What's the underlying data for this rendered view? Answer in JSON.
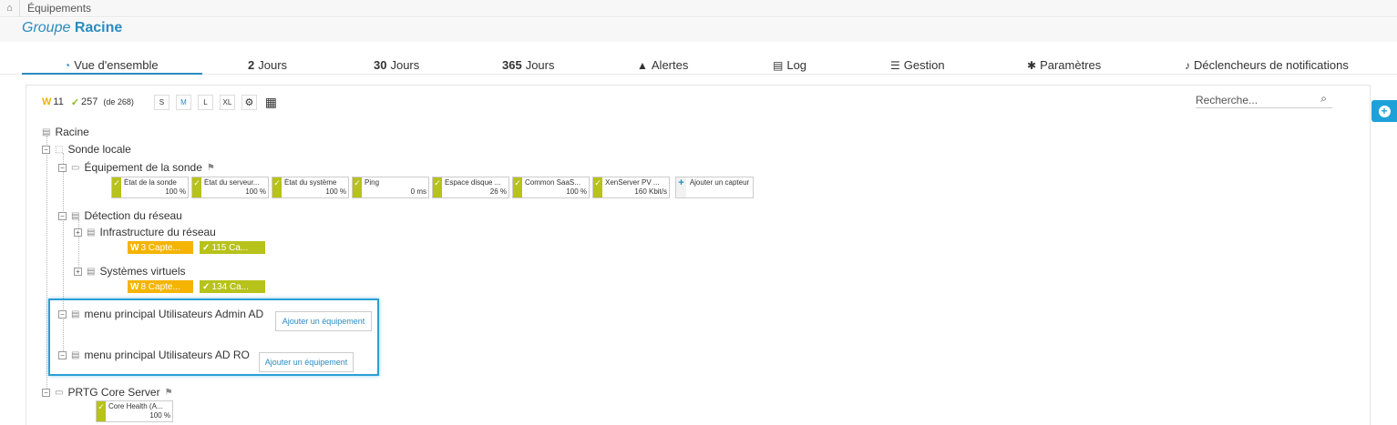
{
  "breadcrumb": {
    "home_icon": "home-icon",
    "item": "Équipements"
  },
  "header": {
    "title_prefix": "Groupe",
    "title_name": "Racine"
  },
  "tabs": [
    {
      "label": "Vue d'ensemble",
      "icon": "overview-icon"
    },
    {
      "num": "2",
      "label": "Jours"
    },
    {
      "num": "30",
      "label": "Jours"
    },
    {
      "num": "365",
      "label": "Jours"
    },
    {
      "label": "Alertes",
      "icon": "warning-icon"
    },
    {
      "label": "Log",
      "icon": "log-icon"
    },
    {
      "label": "Gestion",
      "icon": "sliders-icon"
    },
    {
      "label": "Paramètres",
      "icon": "gear-icon"
    },
    {
      "label": "Déclencheurs de notifications",
      "icon": "bell-icon"
    }
  ],
  "toolbar": {
    "warn_badge": "W",
    "warn_count": "11",
    "ok_count": "257",
    "total": "(de 268)",
    "sizes": [
      "S",
      "M",
      "L",
      "XL"
    ],
    "selected_size": "M"
  },
  "search": {
    "placeholder": "Recherche..."
  },
  "tree": {
    "root": "Racine",
    "probe": "Sonde locale",
    "probe_device": "Équipement de la sonde",
    "sensors": [
      {
        "name": "État de la sonde",
        "value": "100 %"
      },
      {
        "name": "État du serveur...",
        "value": "100 %"
      },
      {
        "name": "État du système",
        "value": "100 %"
      },
      {
        "name": "Ping",
        "value": "0 ms"
      },
      {
        "name": "Espace disque ...",
        "value": "26 %"
      },
      {
        "name": "Common SaaS...",
        "value": "100 %"
      },
      {
        "name": "XenServer PV ...",
        "value": "160 Kbit/s"
      }
    ],
    "add_sensor": "Ajouter un capteur",
    "discovery": "Détection du réseau",
    "infra": "Infrastructure du réseau",
    "infra_warn": "3 Capte...",
    "infra_ok": "115 Ca...",
    "virtual": "Systèmes virtuels",
    "virtual_warn": "8 Capte...",
    "virtual_ok": "134 Ca...",
    "admin_group": "menu principal Utilisateurs Admin AD",
    "ro_group": "menu principal Utilisateurs AD RO",
    "add_device": "Ajouter un équipement",
    "core": "PRTG Core Server",
    "core_sensor": {
      "name": "Core Health (A...",
      "value": "100 %"
    }
  },
  "colors": {
    "accent": "#2a8bbf",
    "ok": "#b7c21b",
    "warn": "#f4b400",
    "highlight": "#2a9fd6"
  }
}
